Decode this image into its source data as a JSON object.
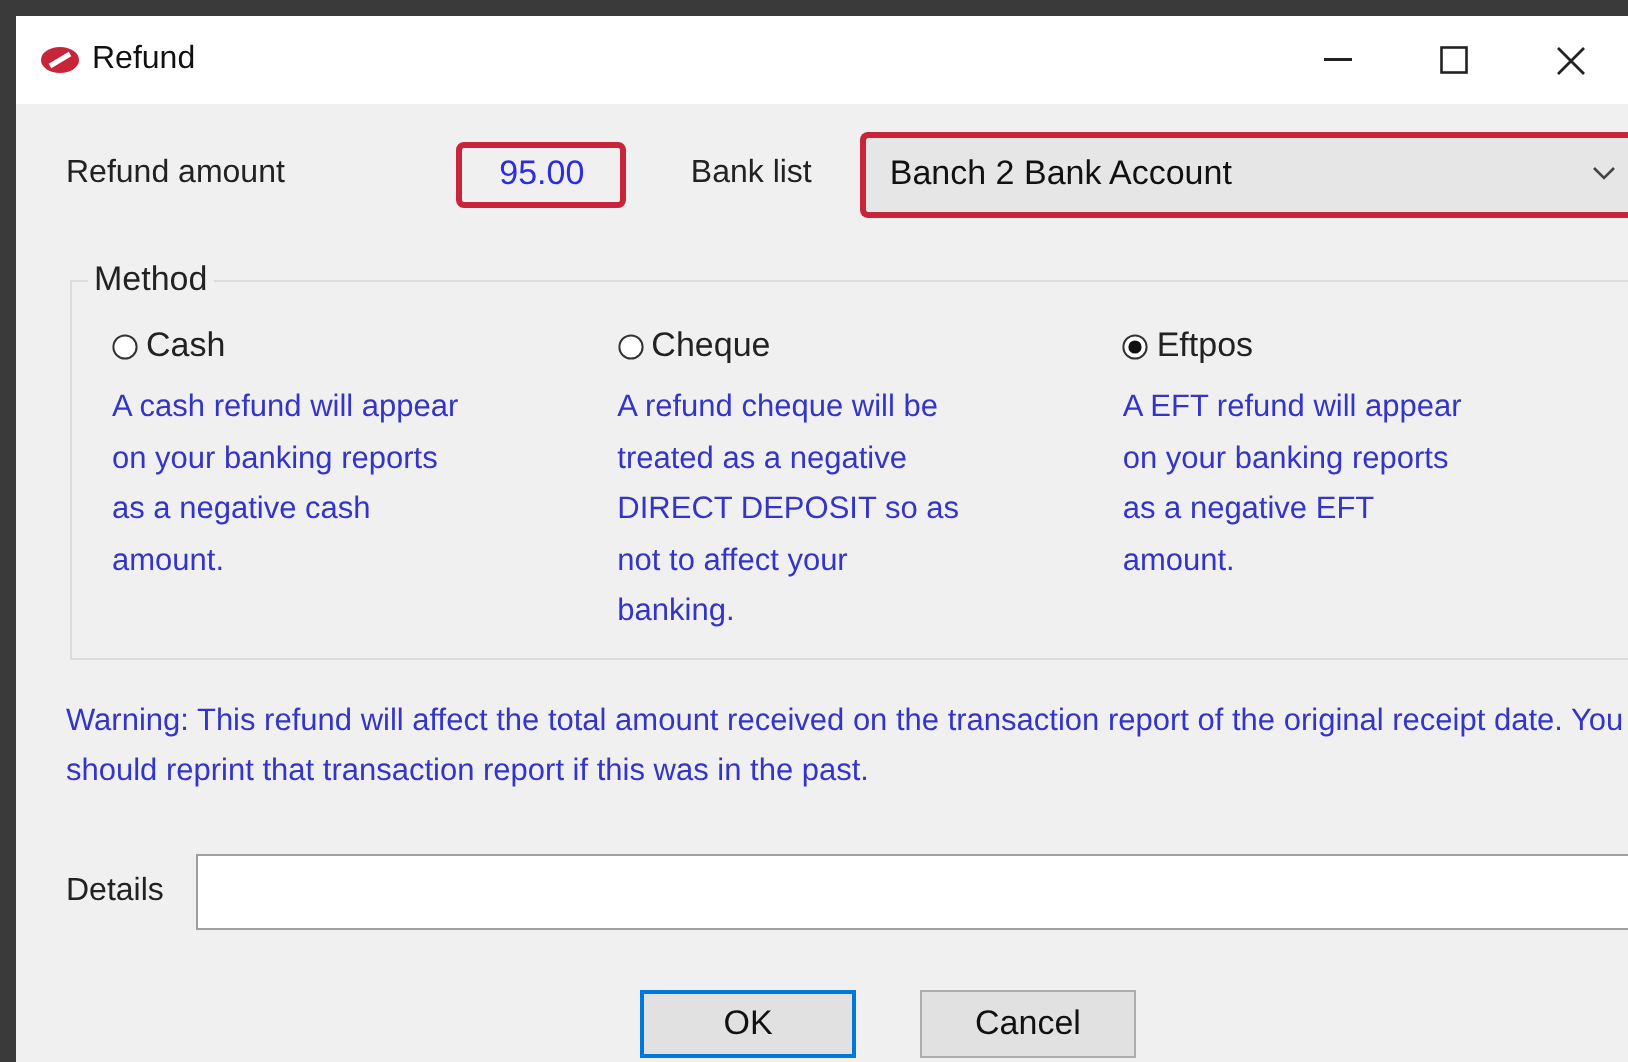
{
  "window": {
    "title": "Refund"
  },
  "refund_amount": {
    "label": "Refund amount",
    "value": "95.00",
    "highlighted": true
  },
  "bank_list": {
    "label": "Bank list",
    "value": "Banch 2 Bank Account",
    "highlighted": true
  },
  "method": {
    "title": "Method",
    "options": [
      {
        "label": "Cash",
        "selected": false,
        "description": "A cash refund will appear on your banking reports as a negative cash amount."
      },
      {
        "label": "Cheque",
        "selected": false,
        "description": "A refund cheque will be treated as a negative DIRECT DEPOSIT so as not to affect your banking."
      },
      {
        "label": "Eftpos",
        "selected": true,
        "description": "A EFT refund will appear on your banking reports as a negative EFT amount."
      }
    ]
  },
  "warning": "Warning: This refund will affect the total amount received on the transaction report of the original receipt date. You should reprint that transaction report if this was in the past.",
  "details": {
    "label": "Details"
  },
  "buttons": [
    {
      "label": "OK",
      "default": true
    },
    {
      "label": "Cancel",
      "default": false
    }
  ]
}
